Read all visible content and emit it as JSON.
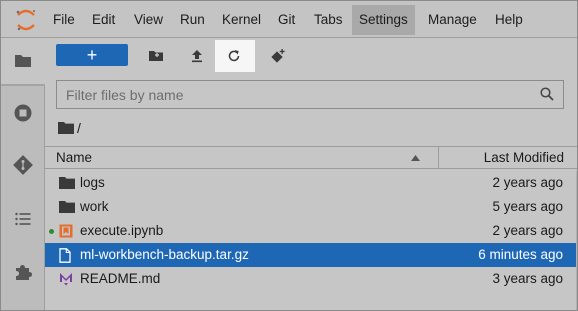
{
  "menu": {
    "items": [
      "File",
      "Edit",
      "View",
      "Run",
      "Kernel",
      "Git",
      "Tabs",
      "Settings",
      "Manage",
      "Help"
    ],
    "active": "Settings"
  },
  "sidebar": {
    "icons": [
      "folder-icon",
      "stop-circle-icon",
      "git-icon",
      "list-icon",
      "puzzle-icon"
    ],
    "active": "folder-icon"
  },
  "toolbar": {
    "new_label": "+",
    "buttons": [
      "new-folder-icon",
      "upload-icon",
      "refresh-icon",
      "git-clone-icon"
    ],
    "highlighted": "refresh-icon"
  },
  "search": {
    "placeholder": "Filter files by name",
    "value": ""
  },
  "breadcrumb": {
    "path": "/"
  },
  "list": {
    "col_name": "Name",
    "col_modified": "Last Modified",
    "sort": "descending",
    "rows": [
      {
        "name": "logs",
        "modified": "2 years ago",
        "type": "folder",
        "selected": false,
        "running": false
      },
      {
        "name": "work",
        "modified": "5 years ago",
        "type": "folder",
        "selected": false,
        "running": false
      },
      {
        "name": "execute.ipynb",
        "modified": "2 years ago",
        "type": "notebook",
        "selected": false,
        "running": true
      },
      {
        "name": "ml-workbench-backup.tar.gz",
        "modified": "6 minutes ago",
        "type": "file",
        "selected": true,
        "running": false
      },
      {
        "name": "README.md",
        "modified": "3 years ago",
        "type": "markdown",
        "selected": false,
        "running": false
      }
    ]
  },
  "colors": {
    "accent": "#1e67b5",
    "notebook": "#e46e2e",
    "markdown": "#7b3fa0",
    "kernel_running": "#2e8a33"
  }
}
